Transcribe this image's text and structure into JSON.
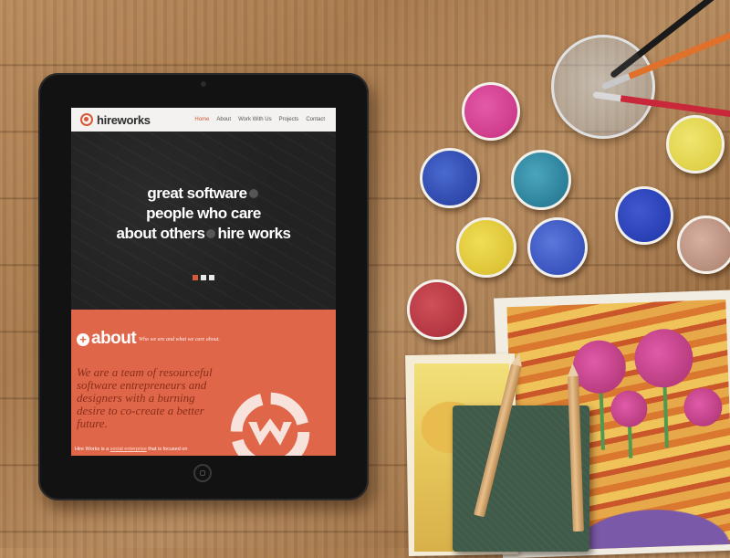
{
  "site": {
    "brand": "hireworks",
    "nav": [
      "Home",
      "About",
      "Work With Us",
      "Projects",
      "Contact"
    ],
    "active_nav": "Home",
    "accent_color": "#e0664a",
    "hero": {
      "line1": "great software",
      "line2": "people who care",
      "line3a": "about others",
      "line3b": "hire works"
    },
    "slider_dots": 3,
    "slider_active": 1,
    "about": {
      "title": "about",
      "subtitle": "Who we are and what we care about.",
      "body": "We are a team of resourceful software entrepreneurs and designers with a burning desire to co-create a better future.",
      "foot_start": "Hire Works is a ",
      "foot_link": "social enterprise",
      "foot_end": " that is focused on"
    }
  },
  "scene": {
    "paint_colors": [
      "#d63a93",
      "#2f4fb5",
      "#2f8fa8",
      "#e5cf33",
      "#3a55c4",
      "#b6373f",
      "#2e48c0",
      "#e7dc4a",
      "#c4988a"
    ]
  }
}
